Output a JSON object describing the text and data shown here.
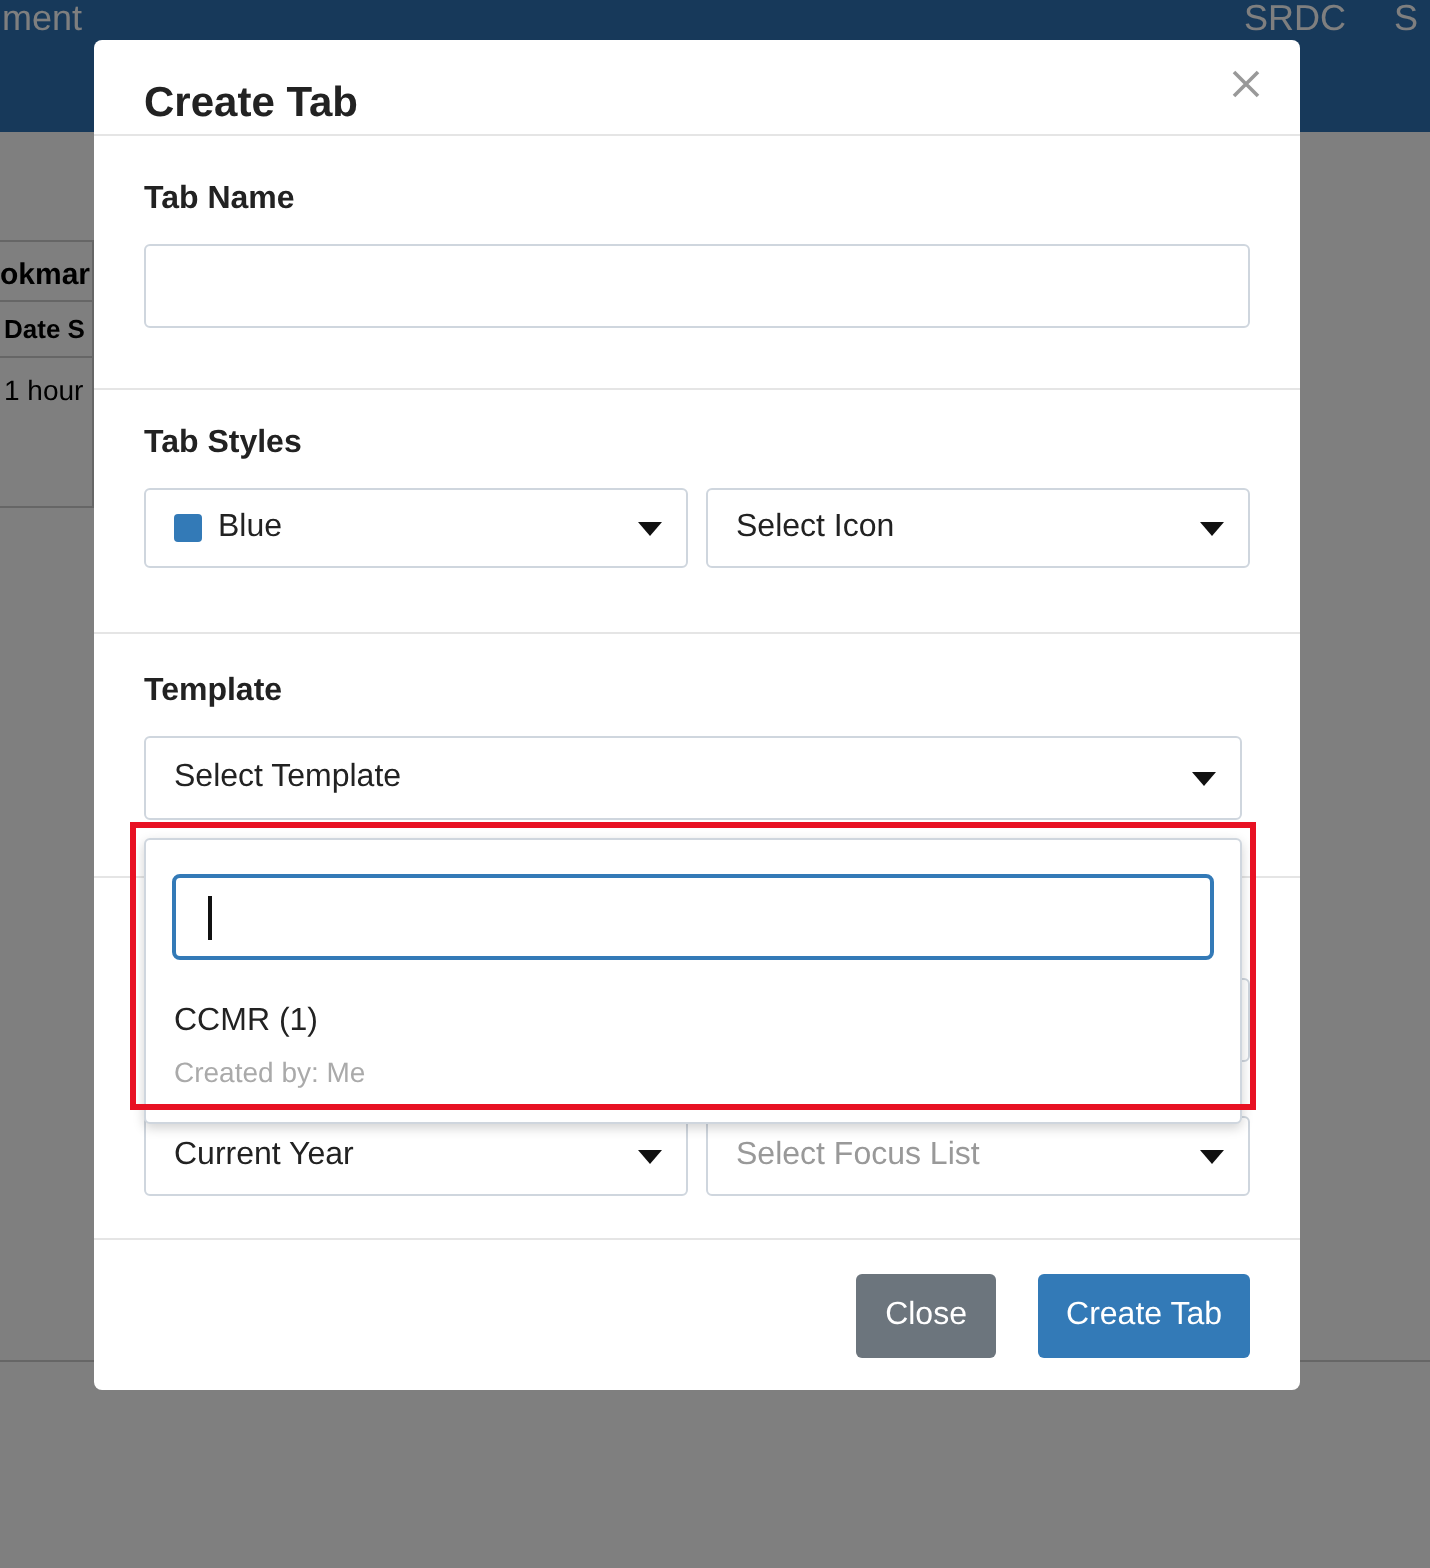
{
  "background": {
    "nav_items": [
      "ment",
      "SRDC",
      "S"
    ],
    "panel": {
      "heading": "okmar",
      "column": "Date S",
      "cell": "1 hour"
    }
  },
  "modal": {
    "title": "Create Tab",
    "tab_name": {
      "label": "Tab Name"
    },
    "tab_styles": {
      "label": "Tab Styles",
      "color_select": {
        "value": "Blue",
        "color": "#337ab7"
      },
      "icon_select": {
        "value": "Select Icon"
      }
    },
    "template": {
      "label": "Template",
      "select": {
        "value": "Select Template"
      },
      "dropdown": {
        "options": [
          {
            "label": "CCMR (1)",
            "meta": "Created by: Me"
          }
        ]
      }
    },
    "filters": {
      "year_select": {
        "value": "Current Year"
      },
      "focus_select": {
        "placeholder": "Select Focus List"
      }
    },
    "buttons": [
      {
        "label": "Close",
        "kind": "secondary"
      },
      {
        "label": "Create Tab",
        "kind": "primary"
      }
    ]
  }
}
